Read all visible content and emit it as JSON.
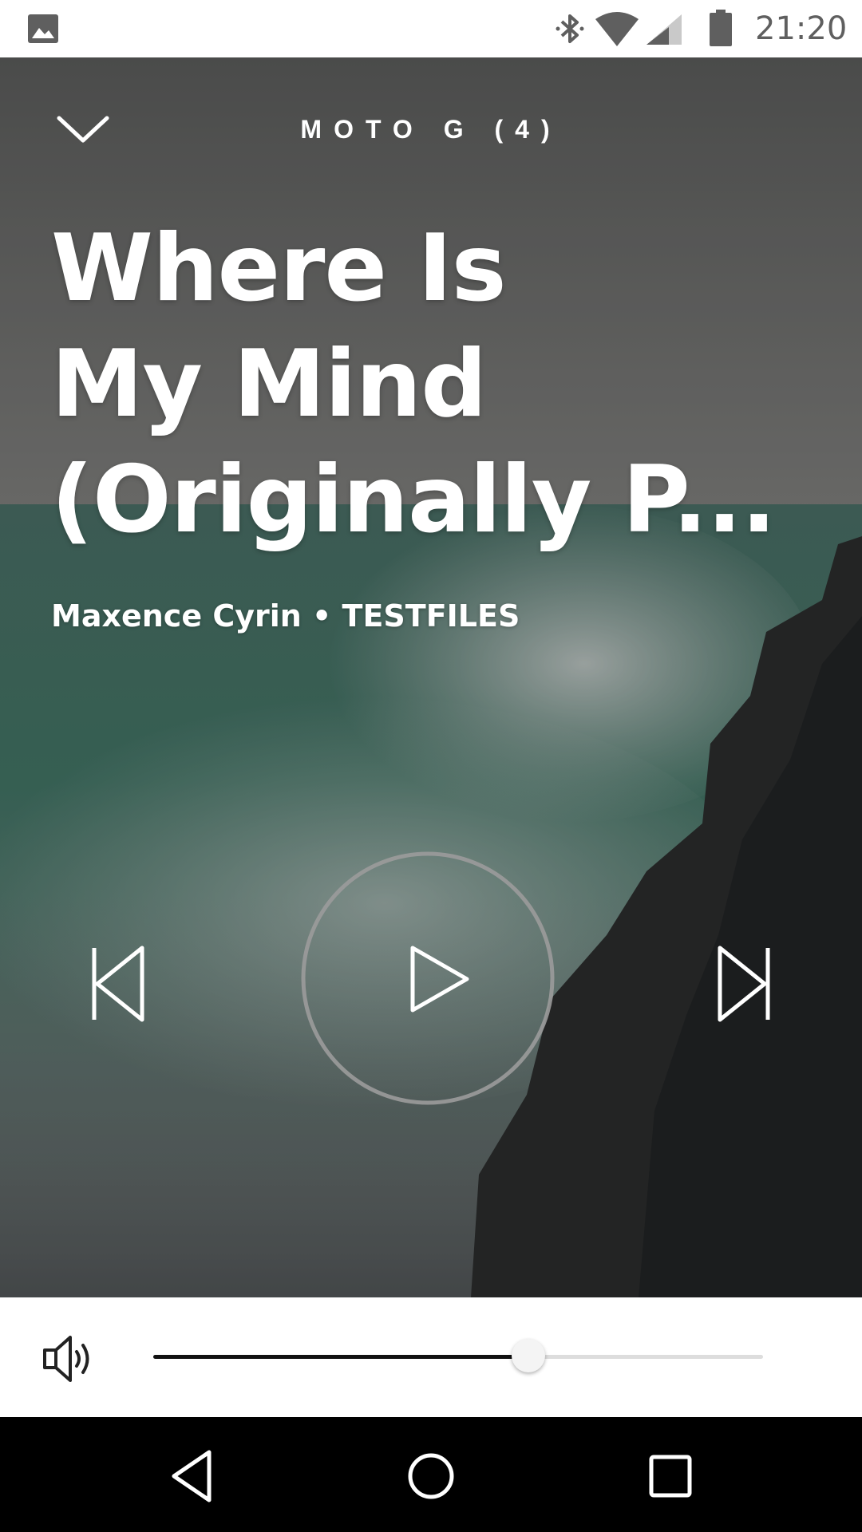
{
  "status_bar": {
    "time": "21:20",
    "icons": [
      "gallery-icon",
      "bluetooth-icon",
      "wifi-icon",
      "cell-signal-icon",
      "battery-icon"
    ]
  },
  "header": {
    "device_name": "MOTO G (4)",
    "collapse_icon": "chevron-down-icon"
  },
  "track": {
    "title_lines": [
      "Where Is",
      "My Mind",
      "(Originally P..."
    ],
    "meta": "Maxence Cyrin • TESTFILES"
  },
  "controls": {
    "previous_icon": "skip-previous-icon",
    "play_icon": "play-icon",
    "next_icon": "skip-next-icon"
  },
  "volume": {
    "icon": "speaker-icon",
    "level": 0.615
  },
  "nav": {
    "icons": [
      "back-icon",
      "home-icon",
      "recents-icon"
    ]
  },
  "colors": {
    "status_bar_bg": "#ffffff",
    "status_icons": "#5f5f5f",
    "text_on_art": "#ffffff",
    "volume_fill": "#111111",
    "volume_track": "#dddddd",
    "nav_bg": "#000000"
  }
}
